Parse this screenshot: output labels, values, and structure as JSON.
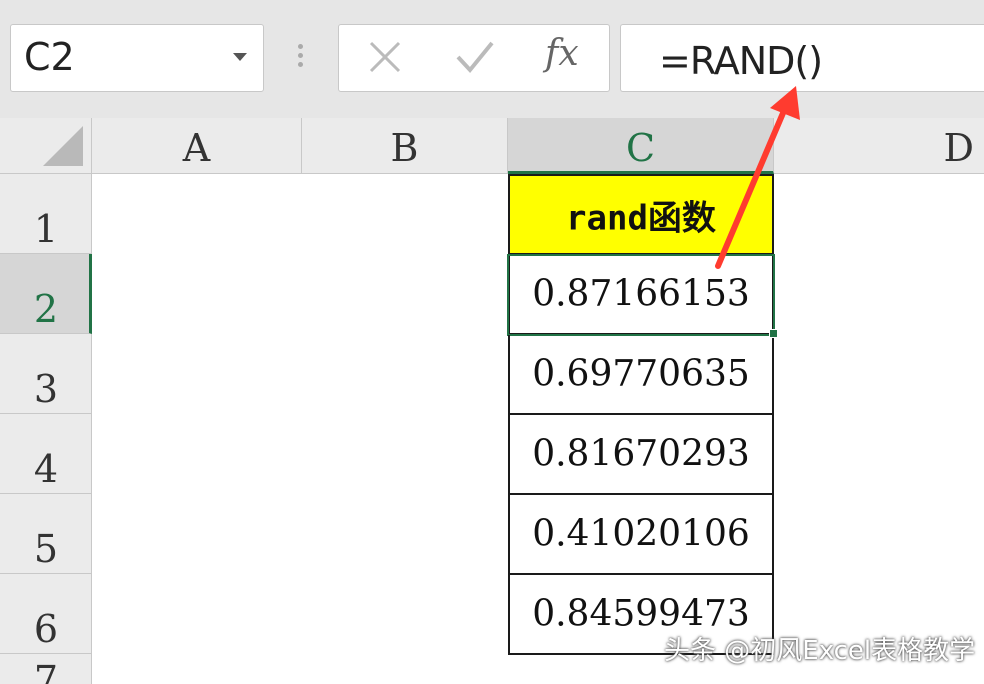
{
  "formula_bar": {
    "name_box": "C2",
    "fx_label": "fx",
    "formula": "=RAND()"
  },
  "columns": [
    "A",
    "B",
    "C",
    "D"
  ],
  "active_column": "C",
  "rows": [
    "1",
    "2",
    "3",
    "4",
    "5",
    "6",
    "7"
  ],
  "active_row": "2",
  "column_c": {
    "header_cell": "rand函数",
    "values": [
      "0.87166153",
      "0.69770635",
      "0.81670293",
      "0.41020106",
      "0.84599473"
    ]
  },
  "colors": {
    "header_fill": "#ffff00",
    "selection": "#217346",
    "arrow": "#ff3b2f"
  },
  "watermark": "头条 @初风Excel表格教学"
}
